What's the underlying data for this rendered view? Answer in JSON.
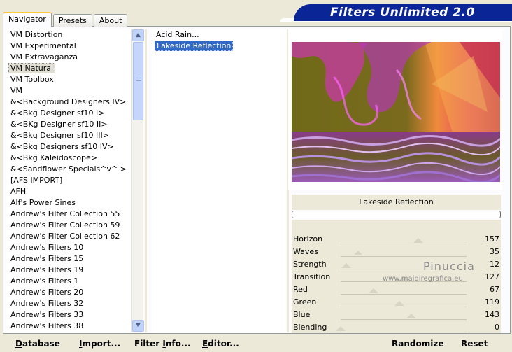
{
  "banner": {
    "title": "Filters Unlimited 2.0"
  },
  "tabs": [
    {
      "label": "Navigator",
      "active": true
    },
    {
      "label": "Presets",
      "active": false
    },
    {
      "label": "About",
      "active": false
    }
  ],
  "categories": [
    "VM Distortion",
    "VM Experimental",
    "VM Extravaganza",
    "VM Natural",
    "VM Toolbox",
    "VM",
    "&<Background Designers IV>",
    "&<Bkg Designer sf10 I>",
    "&<BKg Designer sf10 II>",
    "&<Bkg Designer sf10 III>",
    "&<Bkg Designers sf10 IV>",
    "&<Bkg Kaleidoscope>",
    "&<Sandflower Specials^v^ >",
    "[AFS IMPORT]",
    "AFH",
    "Alf's Power Sines",
    "Andrew's Filter Collection 55",
    "Andrew's Filter Collection 59",
    "Andrew's Filter Collection 62",
    "Andrew's Filters 10",
    "Andrew's Filters 15",
    "Andrew's Filters 19",
    "Andrew's Filters 1",
    "Andrew's Filters 20",
    "Andrew's Filters 32",
    "Andrew's Filters 33",
    "Andrew's Filters 38"
  ],
  "selected_category": "VM Natural",
  "filters": [
    "Acid Rain...",
    "Lakeside Reflection"
  ],
  "selected_filter": "Lakeside Reflection",
  "preview": {
    "filter_name": "Lakeside Reflection"
  },
  "params": [
    {
      "label": "Horizon",
      "value": "157",
      "level": 0.616
    },
    {
      "label": "Waves",
      "value": "35",
      "level": 0.137
    },
    {
      "label": "Strength",
      "value": "12",
      "level": 0.047
    },
    {
      "label": "Transition",
      "value": "127",
      "level": 0.498
    },
    {
      "label": "Red",
      "value": "67",
      "level": 0.263
    },
    {
      "label": "Green",
      "value": "119",
      "level": 0.467
    },
    {
      "label": "Blue",
      "value": "143",
      "level": 0.561
    },
    {
      "label": "Blending",
      "value": "0",
      "level": 0.0
    }
  ],
  "watermark": {
    "name": "Pinuccia",
    "site": "www.maidiregrafica.eu"
  },
  "buttons": {
    "database": {
      "u": "D",
      "rest": "atabase"
    },
    "import": {
      "u": "I",
      "rest": "mport..."
    },
    "filter_info": {
      "pre": "Filter ",
      "u": "I",
      "rest": "nfo..."
    },
    "editor": {
      "u": "E",
      "rest": "ditor..."
    },
    "randomize": "Randomize",
    "reset": "Reset"
  },
  "colors": {
    "banner": "#0a2696",
    "selection": "#316ac5",
    "tab_accent": "#ffc83c"
  }
}
